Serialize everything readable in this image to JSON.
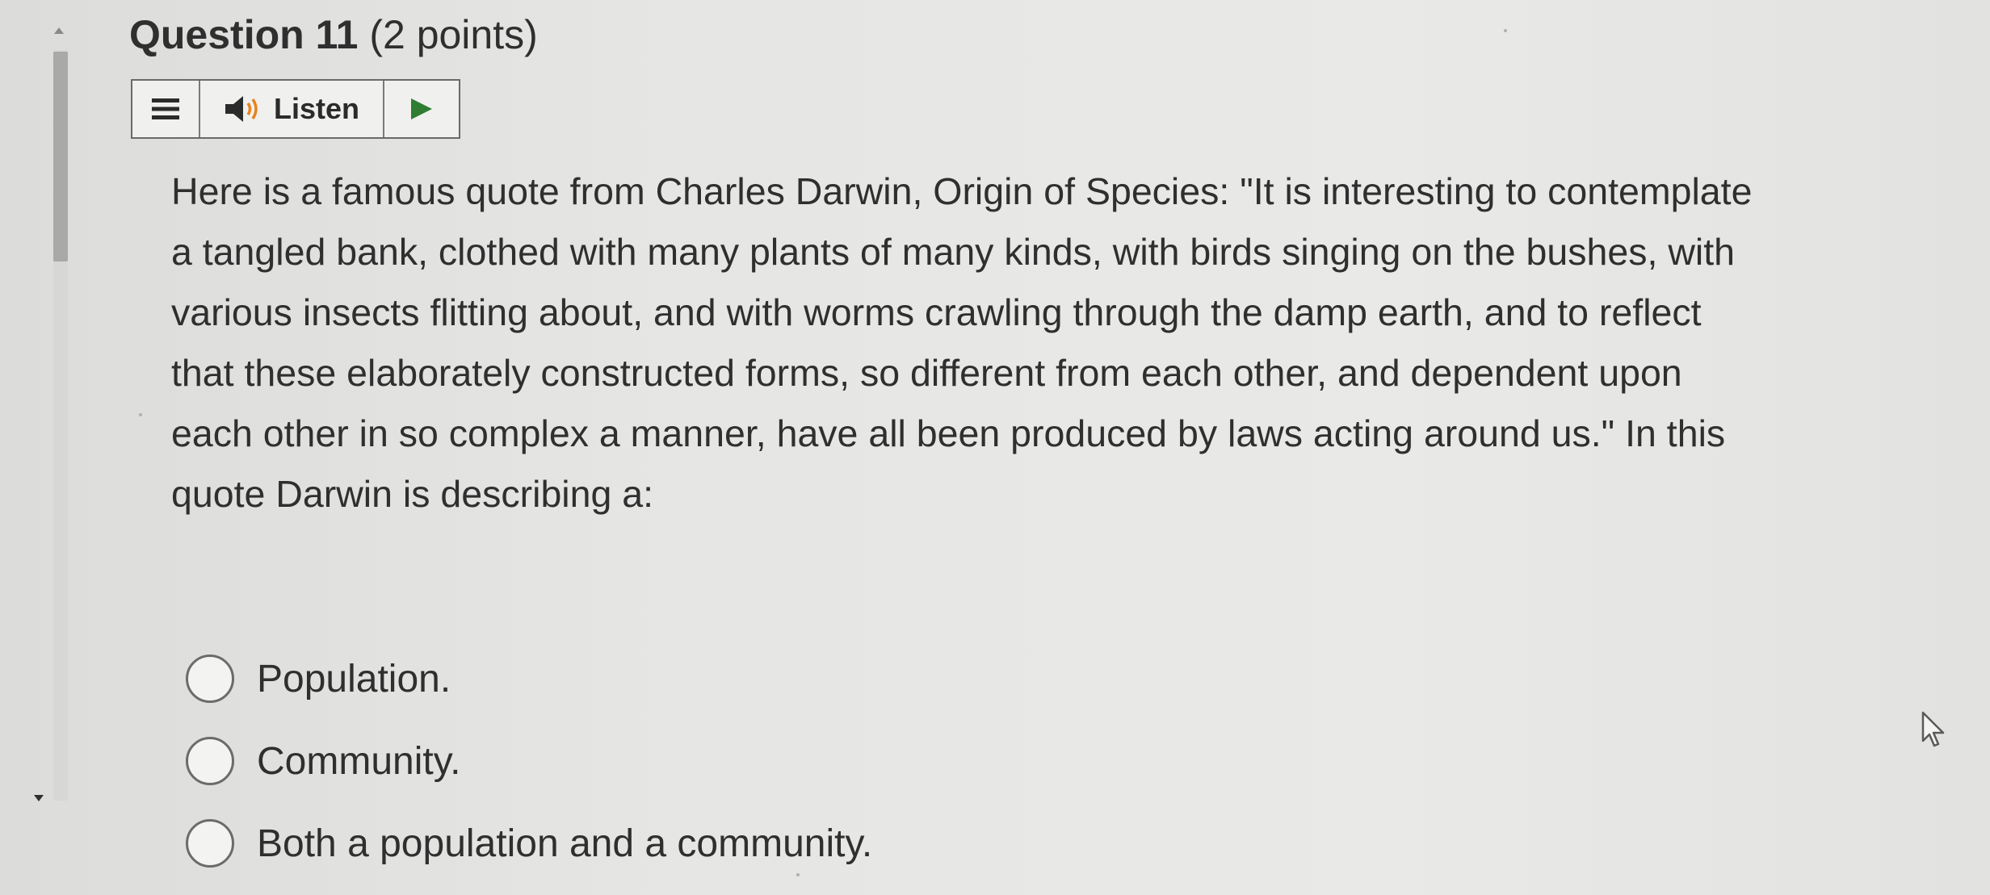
{
  "question": {
    "label": "Question 11",
    "points": "(2 points)"
  },
  "listen_bar": {
    "menu_icon": "hamburger-menu-icon",
    "speaker_icon": "speaker-icon",
    "listen_label": "Listen",
    "play_icon": "play-icon"
  },
  "question_text": "Here is a famous quote from Charles Darwin, Origin of Species: \"It is interesting to contemplate a tangled bank, clothed with many plants of many kinds, with birds singing on the bushes, with various insects flitting about, and with worms crawling through the damp earth, and to reflect that these elaborately constructed forms, so different from each other, and dependent upon each other in so complex a manner, have all been produced by laws acting around us.\" In this quote Darwin is describing a:",
  "options": [
    {
      "label": "Population.",
      "selected": false
    },
    {
      "label": "Community.",
      "selected": false
    },
    {
      "label": "Both a population and a community.",
      "selected": false
    }
  ],
  "colors": {
    "background": "#e6e6e4",
    "text": "#2f2f30",
    "play_green": "#2e7d32",
    "border": "#6a6a6a"
  }
}
